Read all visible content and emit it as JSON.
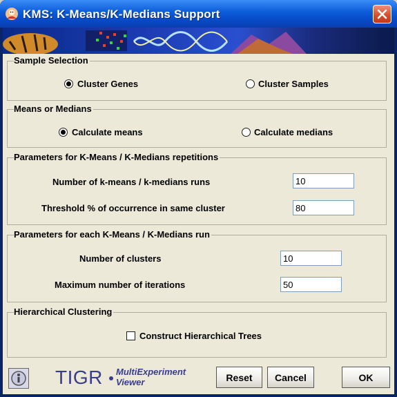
{
  "window": {
    "title": "KMS: K-Means/K-Medians Support"
  },
  "sample_selection": {
    "title": "Sample Selection",
    "options": [
      {
        "label": "Cluster Genes",
        "selected": true
      },
      {
        "label": "Cluster Samples",
        "selected": false
      }
    ]
  },
  "means_medians": {
    "title": "Means or Medians",
    "options": [
      {
        "label": "Calculate means",
        "selected": true
      },
      {
        "label": "Calculate medians",
        "selected": false
      }
    ]
  },
  "repetitions": {
    "title": "Parameters for K-Means / K-Medians repetitions",
    "runs_label": "Number of k-means / k-medians runs",
    "runs_value": "10",
    "threshold_label": "Threshold % of occurrence in same cluster",
    "threshold_value": "80"
  },
  "each_run": {
    "title": "Parameters for each K-Means / K-Medians run",
    "clusters_label": "Number of clusters",
    "clusters_value": "10",
    "iterations_label": "Maximum number of iterations",
    "iterations_value": "50"
  },
  "hierarchical": {
    "title": "Hierarchical Clustering",
    "checkbox_label": "Construct Hierarchical Trees",
    "checked": false
  },
  "footer": {
    "brand": "TIGR",
    "brand_sub_line1": "MultiExperiment",
    "brand_sub_line2": "Viewer",
    "reset_label": "Reset",
    "cancel_label": "Cancel",
    "ok_label": "OK"
  },
  "colors": {
    "titlebar": "#0a5ad8",
    "panel": "#ece9d8",
    "brand": "#3a3d8c",
    "close": "#d6502e"
  }
}
